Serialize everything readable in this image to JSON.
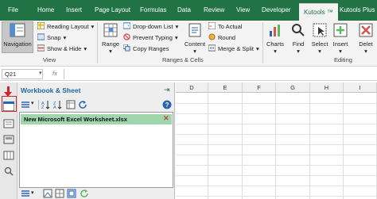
{
  "ribbon_tabs": [
    "File",
    "Home",
    "Insert",
    "Page Layout",
    "Formulas",
    "Data",
    "Review",
    "View",
    "Developer",
    "Kutools ™",
    "Kutools Plus"
  ],
  "view_group": {
    "navigation_label": "Navigation",
    "reading_layout_label": "Reading Layout",
    "snap_label": "Snap",
    "show_hide_label": "Show & Hide",
    "group_label": "View"
  },
  "ranges_cells_group": {
    "range_label": "Range",
    "dropdown_list_label": "Drop-down List",
    "prevent_typing_label": "Prevent Typing",
    "copy_ranges_label": "Copy Ranges",
    "content_label": "Content",
    "to_actual_label": "To Actual",
    "round_label": "Round",
    "merge_split_label": "Merge & Split",
    "group_label": "Ranges & Cells"
  },
  "editing_group": {
    "charts_label": "Charts",
    "find_label": "Find",
    "select_label": "Select",
    "insert_label": "Insert",
    "delete_label": "Delet",
    "group_label": "Editing"
  },
  "formula_bar": {
    "name_box": "Q21",
    "fx": "fx"
  },
  "nav_pane": {
    "title": "Workbook & Sheet",
    "workbook_name": "New Microsoft Excel Worksheet.xlsx"
  },
  "grid": {
    "columns": [
      "D",
      "E",
      "F",
      "G",
      "H",
      "I"
    ]
  },
  "colors": {
    "ribbon_green": "#217346",
    "selected_item": "#9fd6ae",
    "highlight_red": "#d42424",
    "pane_title_blue": "#1a6aa6"
  }
}
